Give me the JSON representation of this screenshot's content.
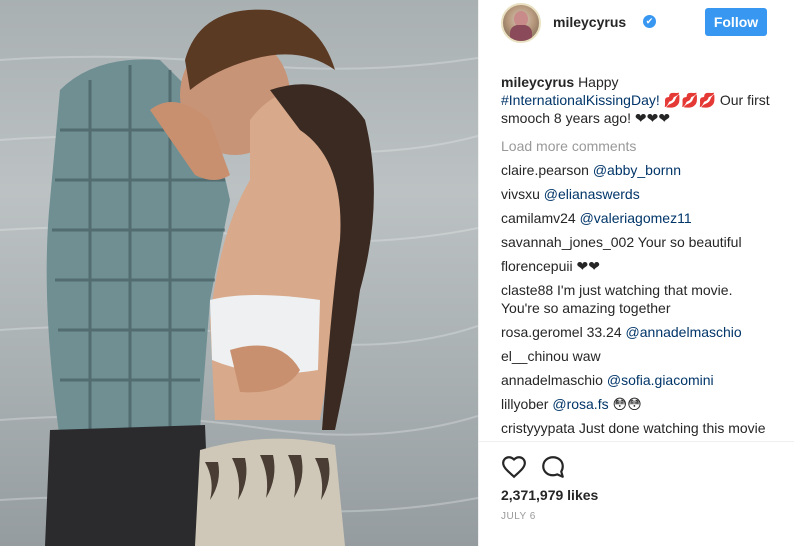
{
  "header": {
    "username": "mileycyrus",
    "verified_glyph": "✔",
    "follow_label": "Follow"
  },
  "caption": {
    "user": "mileycyrus",
    "text_before": "Happy",
    "hashtag": "#InternationalKissingDay!",
    "emoji_lips": "💋💋💋",
    "text_after": "Our first smooch 8 years ago!",
    "emoji_hearts": "❤❤❤"
  },
  "load_more": "Load more comments",
  "comments": [
    {
      "user": "claire.pearson",
      "text": "",
      "mention": "@abby_bornn"
    },
    {
      "user": "vivsxu",
      "text": "",
      "mention": "@elianaswerds"
    },
    {
      "user": "camilamv24",
      "text": "",
      "mention": "@valeriagomez11"
    },
    {
      "user": "savannah_jones_002",
      "text": "Your so beautiful",
      "mention": ""
    },
    {
      "user": "florencepuii",
      "text": "❤❤",
      "mention": ""
    },
    {
      "user": "claste88",
      "text": "I'm just watching that movie. You're so amazing together",
      "mention": ""
    },
    {
      "user": "rosa.geromel",
      "text": "33.24",
      "mention": "@annadelmaschio"
    },
    {
      "user": "el__chinou",
      "text": "waw",
      "mention": ""
    },
    {
      "user": "annadelmaschio",
      "text": "",
      "mention": "@sofia.giacomini"
    },
    {
      "user": "lillyober",
      "text": "",
      "mention": "@rosa.fs",
      "suffix": "😳😳"
    },
    {
      "user": "cristyyypata",
      "text": "Just done watching this movie",
      "mention": ""
    }
  ],
  "actions": {
    "like_icon": "heart-outline-icon",
    "comment_icon": "speech-bubble-icon"
  },
  "likes": "2,371,979 likes",
  "date": "JULY 6",
  "colors": {
    "accent": "#3897f0",
    "link": "#003569",
    "muted": "#999999"
  }
}
